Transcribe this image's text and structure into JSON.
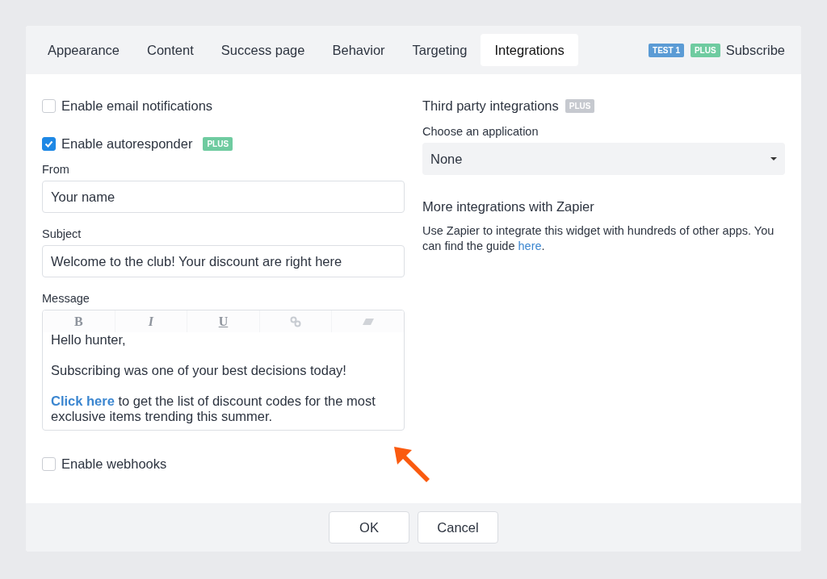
{
  "tabs": [
    {
      "label": "Appearance",
      "selected": false
    },
    {
      "label": "Content",
      "selected": false
    },
    {
      "label": "Success page",
      "selected": false
    },
    {
      "label": "Behavior",
      "selected": false
    },
    {
      "label": "Targeting",
      "selected": false
    },
    {
      "label": "Integrations",
      "selected": true
    }
  ],
  "header_badges": [
    {
      "label": "TEST 1",
      "color": "#5b9bd5"
    },
    {
      "label": "PLUS",
      "color": "#6fcba0"
    }
  ],
  "header_link": "Subscribe",
  "email_notifications": {
    "label": "Enable email notifications",
    "checked": false
  },
  "autoresponder": {
    "label": "Enable autoresponder",
    "checked": true,
    "badge": "PLUS",
    "from": {
      "label": "From",
      "value": "Your name"
    },
    "subject": {
      "label": "Subject",
      "value": "Welcome to the club! Your discount are right here"
    },
    "message": {
      "label": "Message",
      "toolbar": [
        {
          "kind": "bold",
          "label": "B"
        },
        {
          "kind": "italic",
          "label": "I"
        },
        {
          "kind": "underline",
          "label": "U"
        },
        {
          "kind": "link"
        },
        {
          "kind": "eraser"
        }
      ],
      "paragraphs": [
        {
          "text": "Hello hunter,"
        },
        {
          "text": "Subscribing was one of your best decisions today!"
        },
        {
          "link": "Click here",
          "text": " to get the list of discount codes for the most exclusive items trending this summer."
        }
      ]
    }
  },
  "webhooks": {
    "label": "Enable webhooks",
    "checked": false
  },
  "third_party": {
    "title": "Third party integrations",
    "badge": "PLUS",
    "select_label": "Choose an application",
    "select_value": "None"
  },
  "zapier": {
    "title": "More integrations with Zapier",
    "text": "Use Zapier to integrate this widget with hundreds of other apps. You can find the guide ",
    "link": "here",
    "text_end": "."
  },
  "buttons": [
    "OK",
    "Cancel"
  ]
}
